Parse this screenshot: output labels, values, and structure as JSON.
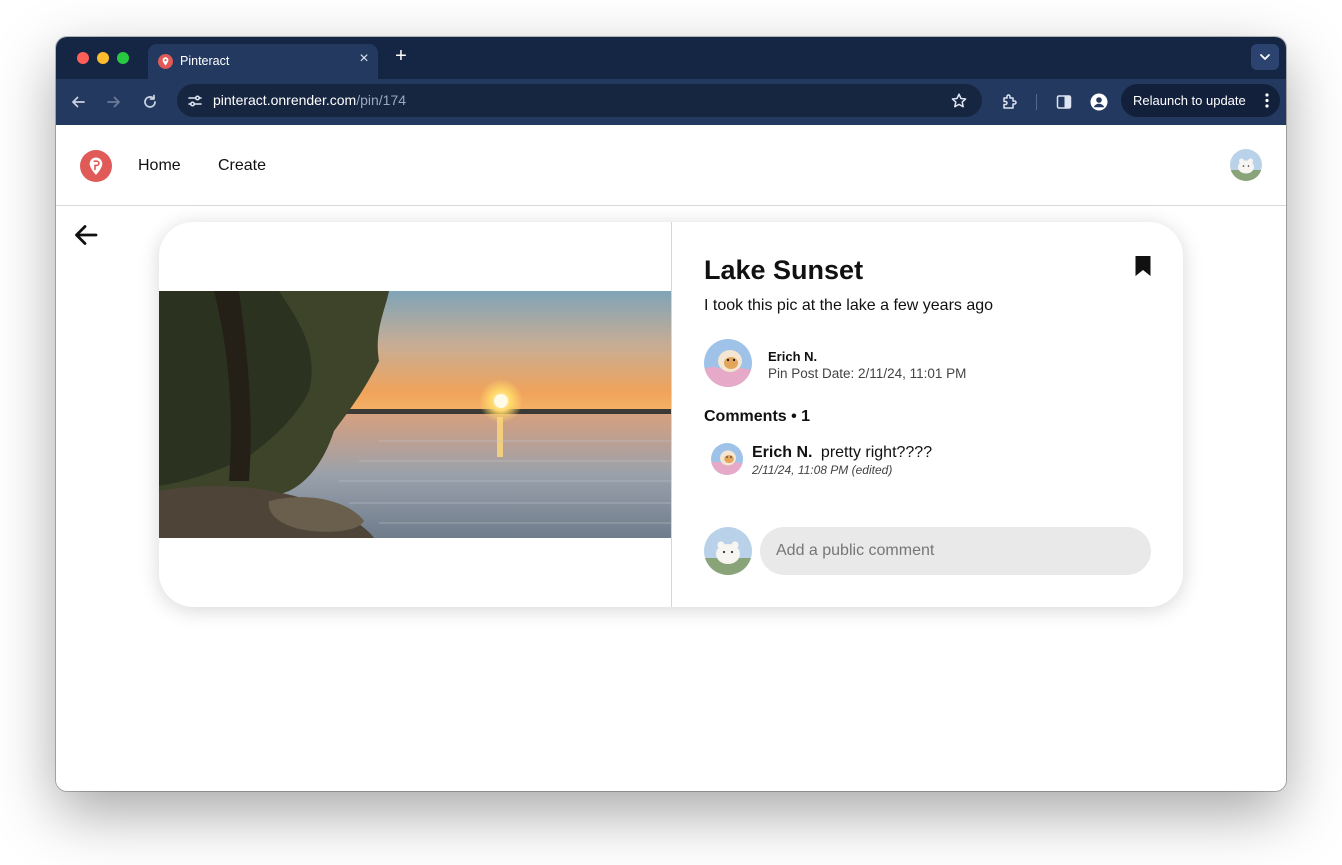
{
  "browser": {
    "tab_title": "Pinteract",
    "tab_close": "×",
    "new_tab": "+",
    "url_host": "pinteract.onrender.com",
    "url_path": "/pin/174",
    "relaunch_label": "Relaunch to update"
  },
  "nav": {
    "home": "Home",
    "create": "Create"
  },
  "pin": {
    "title": "Lake Sunset",
    "description": "I took this pic at the lake a few years ago",
    "author_name": "Erich N.",
    "post_date": "Pin Post Date: 2/11/24, 11:01 PM"
  },
  "comments": {
    "header": "Comments • 1",
    "items": [
      {
        "author": "Erich N.",
        "text": "pretty right????",
        "meta": "2/11/24, 11:08 PM (edited)"
      }
    ],
    "input_placeholder": "Add a public comment"
  },
  "colors": {
    "brand": "#e05a57",
    "tab_strip": "#152544",
    "toolbar": "#23395f"
  },
  "icons": {
    "back": "arrow-left-icon",
    "save": "bookmark-icon",
    "logo": "pin-logo-icon"
  }
}
